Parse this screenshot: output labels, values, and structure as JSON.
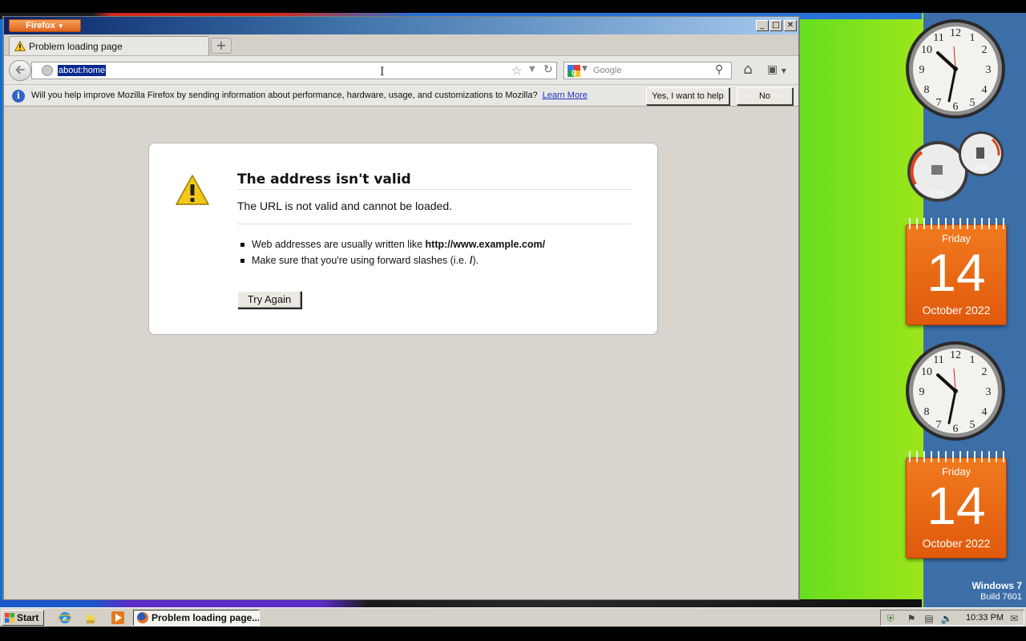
{
  "window": {
    "app_menu_label": "Firefox",
    "tab_title": "Problem loading page",
    "new_tab_label": "+"
  },
  "navbar": {
    "url": "about:home",
    "search_placeholder": "Google"
  },
  "notification": {
    "message": "Will you help improve Mozilla Firefox by sending information about performance, hardware, usage, and customizations to Mozilla?",
    "learn_more": "Learn More",
    "yes_label": "Yes, I want to help",
    "no_label": "No"
  },
  "error": {
    "title": "The address isn't valid",
    "description": "The URL is not valid and cannot be loaded.",
    "hint1_prefix": "Web addresses are usually written like ",
    "hint1_bold": "http://www.example.com/",
    "hint2_prefix": "Make sure that you're using forward slashes (i.e. ",
    "hint2_bold": "/",
    "hint2_suffix": ").",
    "try_again": "Try Again"
  },
  "gadgets": {
    "meter_cpu": "03%",
    "meter_mem": "23%",
    "calendar1": {
      "dow": "Friday",
      "day": "14",
      "month": "October 2022"
    },
    "calendar2": {
      "dow": "Friday",
      "day": "14",
      "month": "October 2022"
    }
  },
  "os": {
    "name": "Windows 7",
    "build": "Build 7601"
  },
  "taskbar": {
    "start": "Start",
    "task_firefox": "Problem loading page...",
    "time": "10:33 PM"
  },
  "colors": {
    "titlebar_start": "#0a246a",
    "firefox_orange": "#e0641d",
    "calendar_orange": "#f07a1e",
    "selection_blue": "#0b2a8f"
  }
}
